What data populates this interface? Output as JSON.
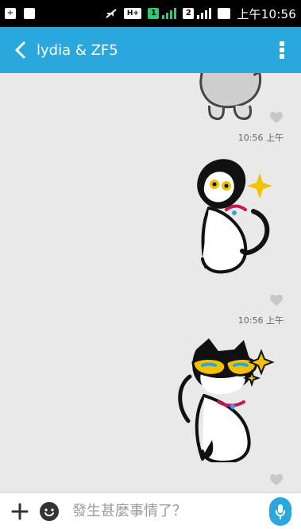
{
  "status_bar": {
    "time": "上午10:56",
    "signal_tag_1": "H+",
    "sim_1": "1",
    "sim_2": "2"
  },
  "header": {
    "title": "lydia & ZF5"
  },
  "messages": [
    {
      "time": "10:56 上午"
    },
    {
      "time": "10:56 上午"
    }
  ],
  "composer": {
    "placeholder": "發生甚麼事情了？"
  },
  "colors": {
    "accent": "#2aa7dc",
    "chat_bg": "#e9e9e9",
    "heart": "#c7c7c7"
  },
  "icons": {
    "back": "chevron-left-icon",
    "menu": "kebab-menu-icon",
    "heart": "heart-icon",
    "add": "plus-icon",
    "emoji": "emoji-icon",
    "mic": "microphone-icon"
  }
}
